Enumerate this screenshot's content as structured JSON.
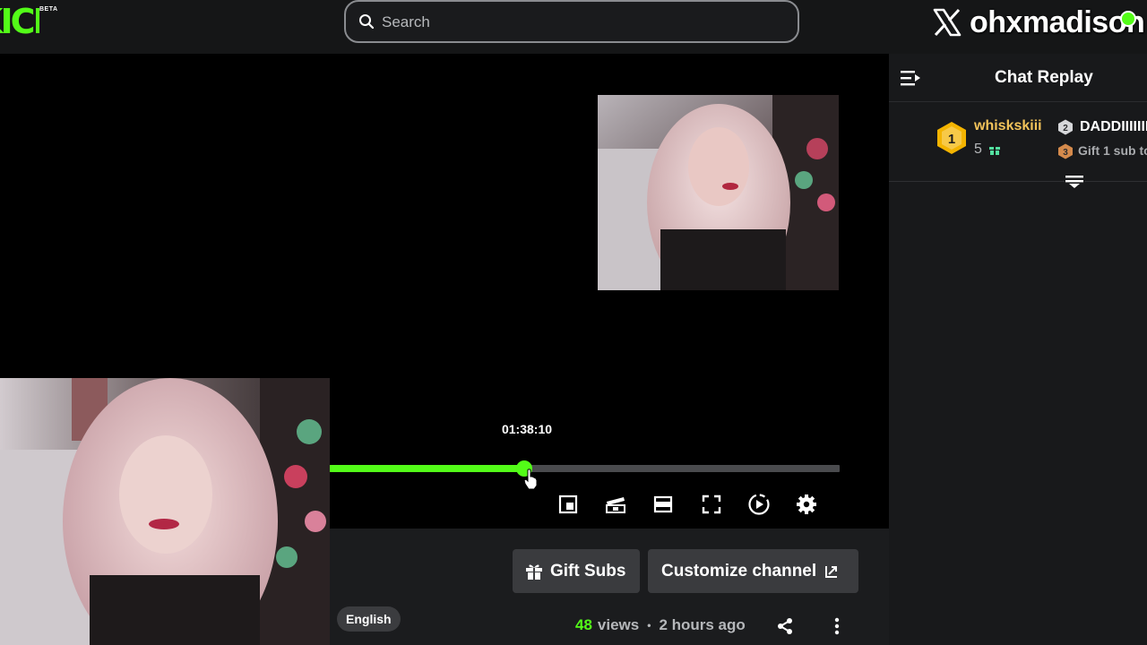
{
  "header": {
    "logo_text": "KICK",
    "beta_label": "BETA",
    "search_placeholder": "Search",
    "overlay_handle": "ohxmadison"
  },
  "player": {
    "timestamp": "01:38:10",
    "progress_fraction": 0.382,
    "controls": [
      "mini-player-icon",
      "theater-icon",
      "clip-icon",
      "fullscreen-icon",
      "playback-speed-icon",
      "settings-gear-icon"
    ]
  },
  "actions": {
    "gift_subs_label": "Gift Subs",
    "customize_channel_label": "Customize channel"
  },
  "stream_info": {
    "language": "English",
    "views_count": "48",
    "views_label": "views",
    "separator": "•",
    "time_ago": "2 hours ago"
  },
  "chat": {
    "title": "Chat Replay",
    "top_gifters": [
      {
        "rank": "1",
        "name": "whiskskiii",
        "count": "5"
      },
      {
        "rank": "2",
        "name": "DADDIIIIIII"
      },
      {
        "rank": "3",
        "text": "Gift 1 sub to"
      }
    ]
  },
  "colors": {
    "brand_green": "#53fc18",
    "gold": "#f2c35a",
    "button_bg": "#3a3b3e"
  }
}
